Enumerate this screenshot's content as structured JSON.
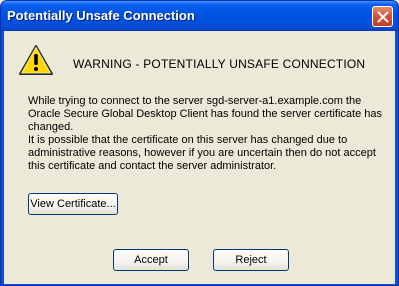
{
  "window": {
    "title": "Potentially Unsafe Connection"
  },
  "dialog": {
    "icon": "warning-icon",
    "heading": "WARNING - POTENTIALLY UNSAFE CONNECTION",
    "message_1": "While trying to connect to the server sgd-server-a1.example.com the Oracle Secure Global Desktop Client has found the server certificate has changed.",
    "message_2": "It is possible that the certificate on this server has changed due to administrative reasons, however if you are uncertain then do not accept this certificate and contact the server administrator.",
    "view_certificate_label": "View Certificate...",
    "accept_label": "Accept",
    "reject_label": "Reject"
  },
  "colors": {
    "titlebar": "#0054e3",
    "close_button": "#c13c23",
    "dialog_background": "#ece9d8",
    "warning_fill": "#ffd800"
  }
}
